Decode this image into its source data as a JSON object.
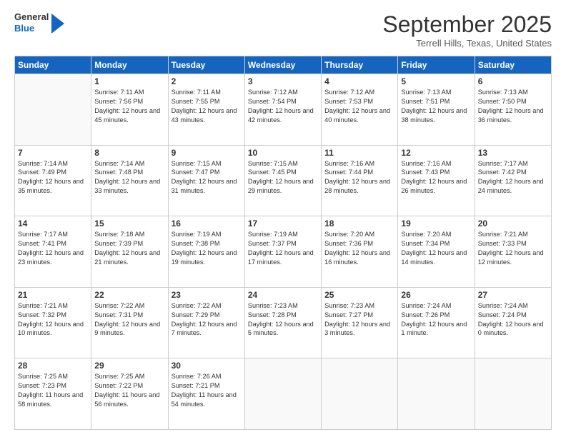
{
  "logo": {
    "general": "General",
    "blue": "Blue"
  },
  "title": "September 2025",
  "location": "Terrell Hills, Texas, United States",
  "days_header": [
    "Sunday",
    "Monday",
    "Tuesday",
    "Wednesday",
    "Thursday",
    "Friday",
    "Saturday"
  ],
  "weeks": [
    [
      {
        "day": "",
        "sunrise": "",
        "sunset": "",
        "daylight": ""
      },
      {
        "day": "1",
        "sunrise": "Sunrise: 7:11 AM",
        "sunset": "Sunset: 7:56 PM",
        "daylight": "Daylight: 12 hours and 45 minutes."
      },
      {
        "day": "2",
        "sunrise": "Sunrise: 7:11 AM",
        "sunset": "Sunset: 7:55 PM",
        "daylight": "Daylight: 12 hours and 43 minutes."
      },
      {
        "day": "3",
        "sunrise": "Sunrise: 7:12 AM",
        "sunset": "Sunset: 7:54 PM",
        "daylight": "Daylight: 12 hours and 42 minutes."
      },
      {
        "day": "4",
        "sunrise": "Sunrise: 7:12 AM",
        "sunset": "Sunset: 7:53 PM",
        "daylight": "Daylight: 12 hours and 40 minutes."
      },
      {
        "day": "5",
        "sunrise": "Sunrise: 7:13 AM",
        "sunset": "Sunset: 7:51 PM",
        "daylight": "Daylight: 12 hours and 38 minutes."
      },
      {
        "day": "6",
        "sunrise": "Sunrise: 7:13 AM",
        "sunset": "Sunset: 7:50 PM",
        "daylight": "Daylight: 12 hours and 36 minutes."
      }
    ],
    [
      {
        "day": "7",
        "sunrise": "Sunrise: 7:14 AM",
        "sunset": "Sunset: 7:49 PM",
        "daylight": "Daylight: 12 hours and 35 minutes."
      },
      {
        "day": "8",
        "sunrise": "Sunrise: 7:14 AM",
        "sunset": "Sunset: 7:48 PM",
        "daylight": "Daylight: 12 hours and 33 minutes."
      },
      {
        "day": "9",
        "sunrise": "Sunrise: 7:15 AM",
        "sunset": "Sunset: 7:47 PM",
        "daylight": "Daylight: 12 hours and 31 minutes."
      },
      {
        "day": "10",
        "sunrise": "Sunrise: 7:15 AM",
        "sunset": "Sunset: 7:45 PM",
        "daylight": "Daylight: 12 hours and 29 minutes."
      },
      {
        "day": "11",
        "sunrise": "Sunrise: 7:16 AM",
        "sunset": "Sunset: 7:44 PM",
        "daylight": "Daylight: 12 hours and 28 minutes."
      },
      {
        "day": "12",
        "sunrise": "Sunrise: 7:16 AM",
        "sunset": "Sunset: 7:43 PM",
        "daylight": "Daylight: 12 hours and 26 minutes."
      },
      {
        "day": "13",
        "sunrise": "Sunrise: 7:17 AM",
        "sunset": "Sunset: 7:42 PM",
        "daylight": "Daylight: 12 hours and 24 minutes."
      }
    ],
    [
      {
        "day": "14",
        "sunrise": "Sunrise: 7:17 AM",
        "sunset": "Sunset: 7:41 PM",
        "daylight": "Daylight: 12 hours and 23 minutes."
      },
      {
        "day": "15",
        "sunrise": "Sunrise: 7:18 AM",
        "sunset": "Sunset: 7:39 PM",
        "daylight": "Daylight: 12 hours and 21 minutes."
      },
      {
        "day": "16",
        "sunrise": "Sunrise: 7:19 AM",
        "sunset": "Sunset: 7:38 PM",
        "daylight": "Daylight: 12 hours and 19 minutes."
      },
      {
        "day": "17",
        "sunrise": "Sunrise: 7:19 AM",
        "sunset": "Sunset: 7:37 PM",
        "daylight": "Daylight: 12 hours and 17 minutes."
      },
      {
        "day": "18",
        "sunrise": "Sunrise: 7:20 AM",
        "sunset": "Sunset: 7:36 PM",
        "daylight": "Daylight: 12 hours and 16 minutes."
      },
      {
        "day": "19",
        "sunrise": "Sunrise: 7:20 AM",
        "sunset": "Sunset: 7:34 PM",
        "daylight": "Daylight: 12 hours and 14 minutes."
      },
      {
        "day": "20",
        "sunrise": "Sunrise: 7:21 AM",
        "sunset": "Sunset: 7:33 PM",
        "daylight": "Daylight: 12 hours and 12 minutes."
      }
    ],
    [
      {
        "day": "21",
        "sunrise": "Sunrise: 7:21 AM",
        "sunset": "Sunset: 7:32 PM",
        "daylight": "Daylight: 12 hours and 10 minutes."
      },
      {
        "day": "22",
        "sunrise": "Sunrise: 7:22 AM",
        "sunset": "Sunset: 7:31 PM",
        "daylight": "Daylight: 12 hours and 9 minutes."
      },
      {
        "day": "23",
        "sunrise": "Sunrise: 7:22 AM",
        "sunset": "Sunset: 7:29 PM",
        "daylight": "Daylight: 12 hours and 7 minutes."
      },
      {
        "day": "24",
        "sunrise": "Sunrise: 7:23 AM",
        "sunset": "Sunset: 7:28 PM",
        "daylight": "Daylight: 12 hours and 5 minutes."
      },
      {
        "day": "25",
        "sunrise": "Sunrise: 7:23 AM",
        "sunset": "Sunset: 7:27 PM",
        "daylight": "Daylight: 12 hours and 3 minutes."
      },
      {
        "day": "26",
        "sunrise": "Sunrise: 7:24 AM",
        "sunset": "Sunset: 7:26 PM",
        "daylight": "Daylight: 12 hours and 1 minute."
      },
      {
        "day": "27",
        "sunrise": "Sunrise: 7:24 AM",
        "sunset": "Sunset: 7:24 PM",
        "daylight": "Daylight: 12 hours and 0 minutes."
      }
    ],
    [
      {
        "day": "28",
        "sunrise": "Sunrise: 7:25 AM",
        "sunset": "Sunset: 7:23 PM",
        "daylight": "Daylight: 11 hours and 58 minutes."
      },
      {
        "day": "29",
        "sunrise": "Sunrise: 7:25 AM",
        "sunset": "Sunset: 7:22 PM",
        "daylight": "Daylight: 11 hours and 56 minutes."
      },
      {
        "day": "30",
        "sunrise": "Sunrise: 7:26 AM",
        "sunset": "Sunset: 7:21 PM",
        "daylight": "Daylight: 11 hours and 54 minutes."
      },
      {
        "day": "",
        "sunrise": "",
        "sunset": "",
        "daylight": ""
      },
      {
        "day": "",
        "sunrise": "",
        "sunset": "",
        "daylight": ""
      },
      {
        "day": "",
        "sunrise": "",
        "sunset": "",
        "daylight": ""
      },
      {
        "day": "",
        "sunrise": "",
        "sunset": "",
        "daylight": ""
      }
    ]
  ]
}
